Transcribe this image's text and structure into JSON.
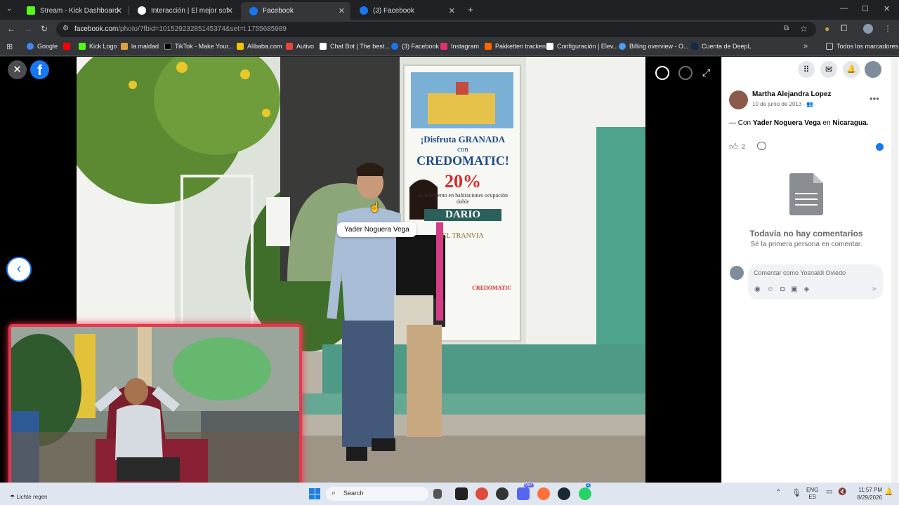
{
  "tabs": [
    {
      "title": "Stream - Kick Dashboard",
      "color": "#53fc18"
    },
    {
      "title": "Interacción | El mejor software y",
      "color": "#ffffff"
    },
    {
      "title": "Facebook",
      "color": "#1877f2"
    },
    {
      "title": "(3) Facebook",
      "color": "#1877f2"
    }
  ],
  "address": {
    "host": "facebook.com",
    "path": "/photo/?fbid=10152923285145374&set=t.1755685989"
  },
  "bookmarks": [
    {
      "label": "Google",
      "color": "#4285f4"
    },
    {
      "label": "",
      "color": "#ff0000"
    },
    {
      "label": "Kick Logo",
      "color": "#53fc18"
    },
    {
      "label": "la maldad",
      "color": "#d9a441"
    },
    {
      "label": "TikTok - Make Your...",
      "color": "#000000"
    },
    {
      "label": "Alibaba.com",
      "color": "#f5c400"
    },
    {
      "label": "Autivo",
      "color": "#e8453c"
    },
    {
      "label": "Chat Bot | The best...",
      "color": "#ffffff"
    },
    {
      "label": "(3) Facebook",
      "color": "#1877f2"
    },
    {
      "label": "Instagram",
      "color": "#e1306c"
    },
    {
      "label": "Pakketten tracken",
      "color": "#ff6600"
    },
    {
      "label": "Configuración | Elev...",
      "color": "#ffffff"
    },
    {
      "label": "Billing overview - O...",
      "color": "#4a9ff5"
    },
    {
      "label": "Cuenta de DeepL",
      "color": "#0f2b46"
    }
  ],
  "bookmarks_all": "Todos los marcadores",
  "viewer": {
    "tag_label": "Yader Noguera Vega",
    "banner": {
      "line1": "¡Disfruta GRANADA",
      "line2": "con",
      "brand": "CREDOMATIC!",
      "pct": "20%",
      "desc": "de descuento en habitaciones ocupación doble",
      "hotel": "DARIO",
      "tranvia": "EL TRANVIA",
      "footer": "CREDOMATIC"
    }
  },
  "post": {
    "author": "Martha Alejandra Lopez",
    "date": "10 de junio de 2013 ·",
    "with_prefix": "— Con",
    "tagged": "Yader Noguera Vega",
    "in_word": "en",
    "place": "Nicaragua.",
    "likes": "2",
    "empty_title": "Todavía no hay comentarios",
    "empty_sub": "Sé la primera persona en comentar.",
    "comment_placeholder": "Comentar como Yosnaldi Oviedo"
  },
  "taskbar": {
    "search": "Search",
    "weather": "Lichte regen",
    "lang1": "ENG",
    "lang2": "ES",
    "time": "11:57 PM",
    "date": "8/29/2026",
    "discord_badge": "99+",
    "whatsapp_badge": "2"
  }
}
